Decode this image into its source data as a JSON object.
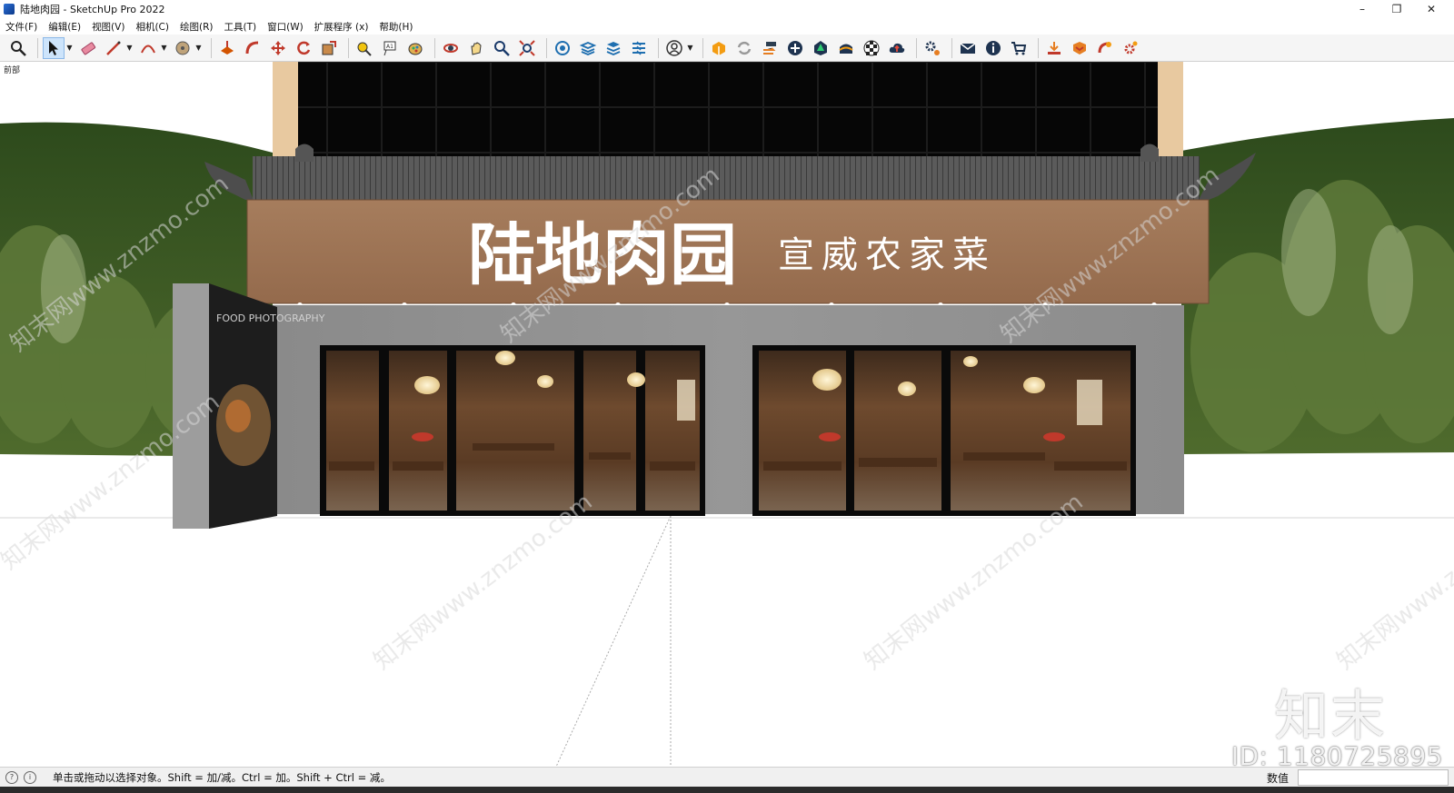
{
  "window": {
    "title": "陆地肉园 - SketchUp Pro 2022",
    "minimize_glyph": "–",
    "maximize_glyph": "❐",
    "close_glyph": "✕"
  },
  "menu": {
    "items": [
      "文件(F)",
      "编辑(E)",
      "视图(V)",
      "相机(C)",
      "绘图(R)",
      "工具(T)",
      "窗口(W)",
      "扩展程序 (x)",
      "帮助(H)"
    ]
  },
  "toolbar": {
    "icons": [
      "zoom-window-icon",
      "select-icon",
      "eraser-icon",
      "line-icon",
      "arc-icon",
      "paint-bucket-icon",
      "push-pull-icon",
      "follow-me-icon",
      "move-icon",
      "rotate-icon",
      "scale-icon",
      "tape-measure-icon",
      "text-icon",
      "paint-icon",
      "orbit-icon",
      "pan-icon",
      "zoom-icon",
      "zoom-extents-icon",
      "component-icon",
      "layers-icon",
      "styles-icon",
      "outliner-icon",
      "account-icon",
      "extension-warehouse-icon",
      "sync-icon",
      "export-icon",
      "add-icon",
      "tree-icon",
      "sandbox-icon",
      "checker-icon",
      "cloud-icon",
      "settings-icon",
      "mail-icon",
      "info-icon",
      "cart-icon",
      "download-icon",
      "plugin-icon",
      "ruby-icon",
      "gear-icon"
    ]
  },
  "viewport": {
    "scene_label": "前部",
    "sign_main": "陆地肉园",
    "sign_sub": "宣威农家菜",
    "poster_text": "FOOD PHOTOGRAPHY",
    "watermark": "知末网www.znzmo.com"
  },
  "status": {
    "hint": "单击或拖动以选择对象。Shift = 加/减。Ctrl = 加。Shift + Ctrl = 减。",
    "vcb_label": "数值",
    "vcb_value": ""
  },
  "watermark": {
    "logo": "知末",
    "id": "ID: 1180725895"
  },
  "colors": {
    "accent_select": "#cde4fb",
    "sign_board": "#a07657",
    "wall_gray": "#8e8e8e",
    "roof_tile": "#5a5a5a",
    "green_backdrop": "#35521f"
  }
}
